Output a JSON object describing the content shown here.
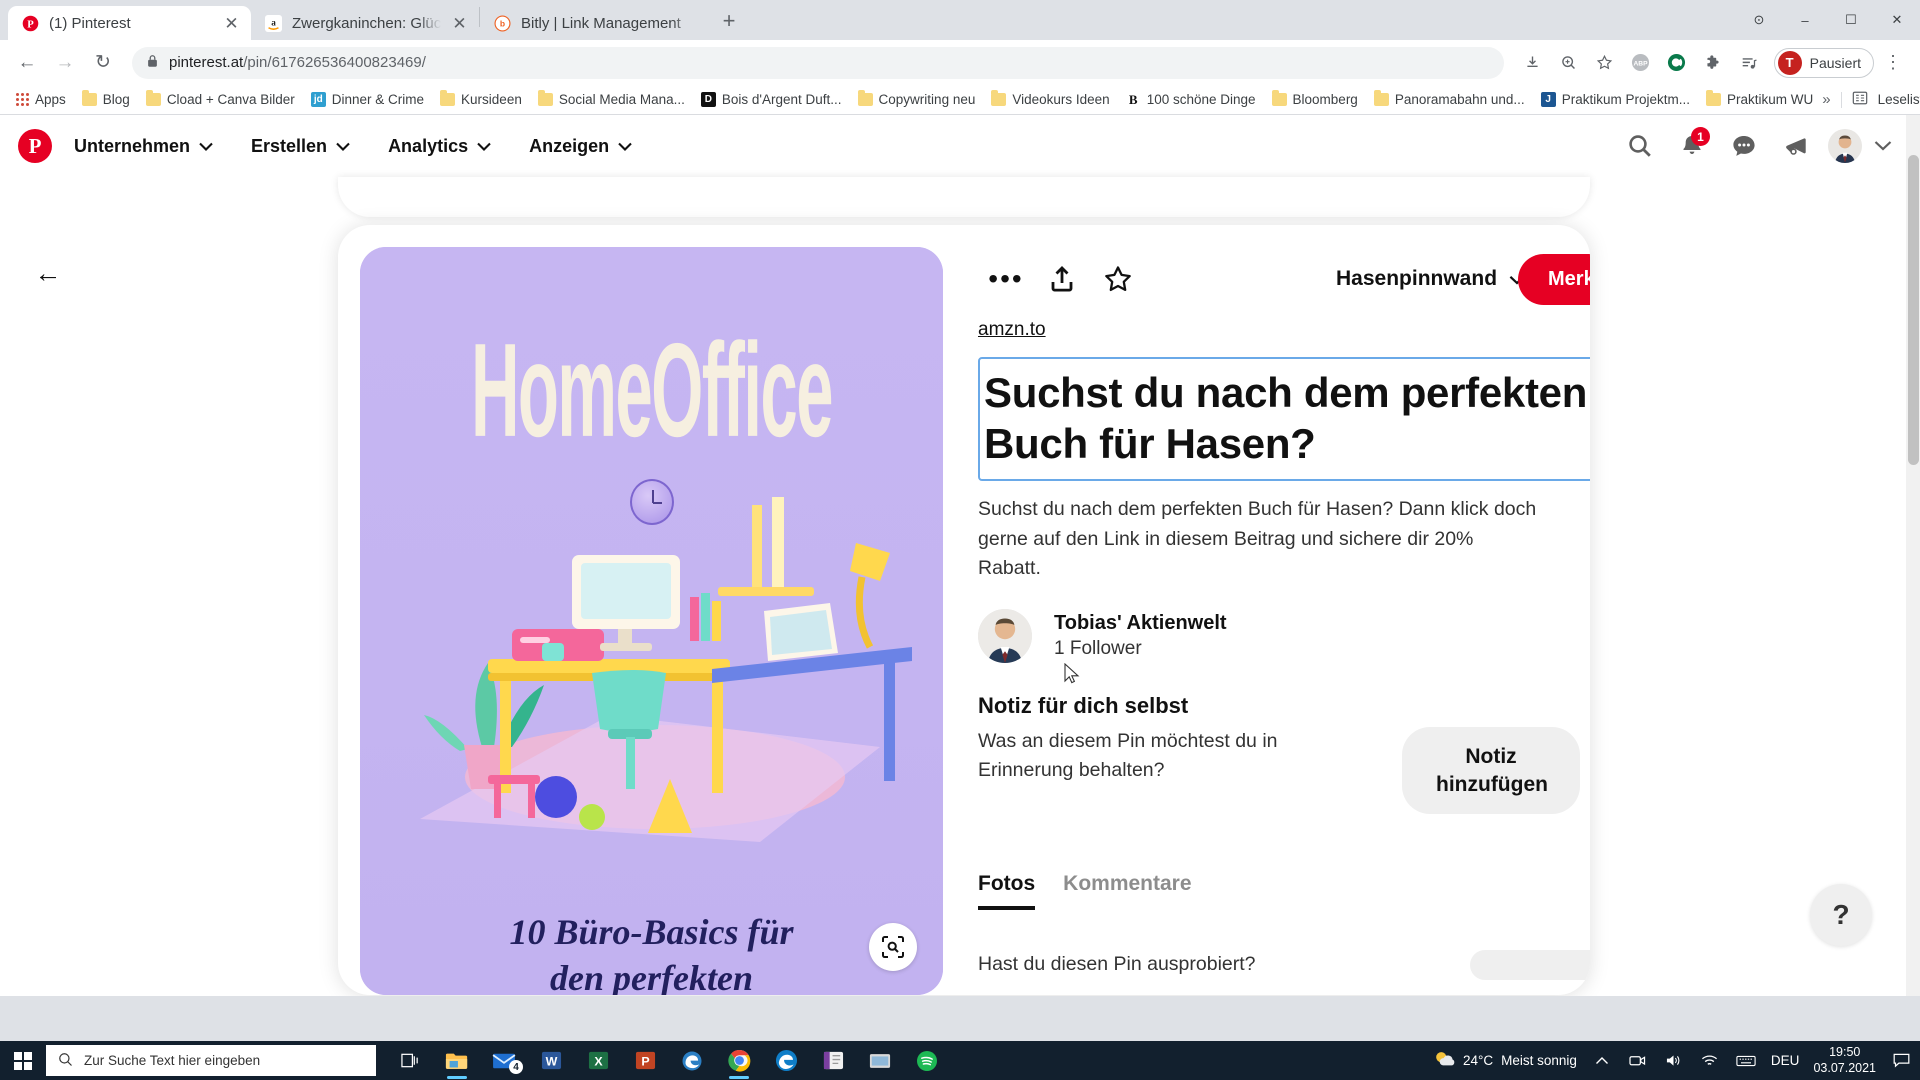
{
  "browser": {
    "tabs": [
      {
        "title": "(1) Pinterest",
        "favicon": "pinterest-icon",
        "active": true,
        "close": "✕"
      },
      {
        "title": "Zwergkaninchen: Glücklich durch",
        "favicon": "amazon-icon",
        "active": false,
        "close": "✕"
      },
      {
        "title": "Bitly | Link Management",
        "favicon": "bitly-icon",
        "active": false,
        "close": ""
      }
    ],
    "new_tab_label": "+",
    "window_controls": {
      "minimize": "–",
      "maximize": "☐",
      "close": "✕",
      "extra": "⊙"
    },
    "toolbar": {
      "back": "←",
      "forward": "→",
      "reload": "↻",
      "lock_icon": "lock-icon",
      "url_host": "pinterest.at",
      "url_path": "/pin/617626536400823469/",
      "right_icons": [
        "install-icon",
        "zoom-icon",
        "bookmark-star-icon",
        "abp-icon",
        "c-icon",
        "extensions-icon",
        "media-list-icon"
      ],
      "profile_initial": "T",
      "profile_label": "Pausiert",
      "menu": "⋮"
    },
    "bookmarks": {
      "apps_label": "Apps",
      "items": [
        {
          "label": "Blog",
          "icon": "folder"
        },
        {
          "label": "Cload + Canva Bilder",
          "icon": "folder"
        },
        {
          "label": "Dinner & Crime",
          "icon": "site",
          "letters": "jd",
          "color": "#2f9fd0"
        },
        {
          "label": "Kursideen",
          "icon": "folder"
        },
        {
          "label": "Social Media Mana...",
          "icon": "folder"
        },
        {
          "label": "Bois d'Argent Duft...",
          "icon": "site",
          "letters": "D",
          "color": "#111111"
        },
        {
          "label": "Copywriting neu",
          "icon": "folder"
        },
        {
          "label": "Videokurs Ideen",
          "icon": "folder"
        },
        {
          "label": "100 schöne Dinge",
          "icon": "site",
          "letters": "B",
          "color": "#ffffff",
          "textcolor": "#111111"
        },
        {
          "label": "Bloomberg",
          "icon": "folder"
        },
        {
          "label": "Panoramabahn und...",
          "icon": "folder"
        },
        {
          "label": "Praktikum Projektm...",
          "icon": "site",
          "letters": "J",
          "color": "#1c5692"
        },
        {
          "label": "Praktikum WU",
          "icon": "folder"
        }
      ],
      "overflow": "»",
      "reading_list": "Leseliste",
      "reading_list_icon": "reading-list-icon"
    }
  },
  "pinterest": {
    "logo": "P",
    "nav": [
      {
        "label": "Unternehmen",
        "caret": "⌄"
      },
      {
        "label": "Erstellen",
        "caret": "⌄"
      },
      {
        "label": "Analytics",
        "caret": "⌄"
      },
      {
        "label": "Anzeigen",
        "caret": "⌄"
      }
    ],
    "header_icons": [
      {
        "name": "search-icon",
        "badge": ""
      },
      {
        "name": "bell-icon",
        "badge": "1"
      },
      {
        "name": "messages-icon",
        "badge": ""
      },
      {
        "name": "megaphone-icon",
        "badge": ""
      }
    ],
    "account_caret": "⌄",
    "back_arrow": "←"
  },
  "pin": {
    "image": {
      "headline": "HomeOffice",
      "caption_line1": "10 Büro-Basics für",
      "caption_line2": "den perfekten",
      "zoom_icon": "visual-search-icon",
      "bg_color": "#c4b4f1",
      "headline_color": "#f6efe0",
      "caption_color": "#22205e"
    },
    "actions": {
      "more": "•••",
      "share_icon": "share-icon",
      "favorite_icon": "star-icon",
      "board_name": "Hasenpinnwand",
      "board_caret": "⌄",
      "save_label": "Merken"
    },
    "source_link": "amzn.to",
    "title": "Suchst du nach dem perfekten Buch für Hasen?",
    "description": "Suchst du nach dem perfekten Buch für Hasen? Dann klick doch gerne auf den Link in diesem Beitrag und sichere dir 20% Rabatt.",
    "author": {
      "name": "Tobias' Aktienwelt",
      "followers": "1 Follower",
      "avatar": "user-avatar"
    },
    "note": {
      "heading": "Notiz für dich selbst",
      "question": "Was an diesem Pin möchtest du in Erinnerung behalten?",
      "button": "Notiz hinzufügen"
    },
    "tabs": [
      {
        "label": "Fotos",
        "active": true
      },
      {
        "label": "Kommentare",
        "active": false
      }
    ],
    "tried_question": "Hast du diesen Pin ausprobiert?",
    "help_label": "?"
  },
  "taskbar": {
    "start_icon": "windows-icon",
    "search_placeholder": "Zur Suche Text hier eingeben",
    "search_icon": "search-icon",
    "task_view_icon": "task-view-icon",
    "apps": [
      {
        "name": "file-explorer-icon",
        "badge": ""
      },
      {
        "name": "mail-icon",
        "badge": "4"
      },
      {
        "name": "word-icon",
        "badge": ""
      },
      {
        "name": "excel-icon",
        "badge": ""
      },
      {
        "name": "powerpoint-icon",
        "badge": ""
      },
      {
        "name": "edge-legacy-icon",
        "badge": ""
      },
      {
        "name": "chrome-icon",
        "badge": ""
      },
      {
        "name": "edge-icon",
        "badge": ""
      },
      {
        "name": "onenote-icon",
        "badge": ""
      },
      {
        "name": "explorer2-icon",
        "badge": ""
      },
      {
        "name": "spotify-icon",
        "badge": ""
      }
    ],
    "weather": {
      "icon": "sun-cloud-icon",
      "temp": "24°C",
      "text": "Meist sonnig"
    },
    "tray_icons": [
      "chevron-up-icon",
      "camera-icon",
      "volume-icon",
      "wifi-icon",
      "keyboard-icon"
    ],
    "language": "DEU",
    "time": "19:50",
    "date": "03.07.2021",
    "action_center_icon": "action-center-icon"
  },
  "colors": {
    "pinterest_red": "#e60023",
    "chrome_tabstrip": "#dee1e6",
    "taskbar": "#12202e",
    "title_outline": "#6aa9e8"
  }
}
